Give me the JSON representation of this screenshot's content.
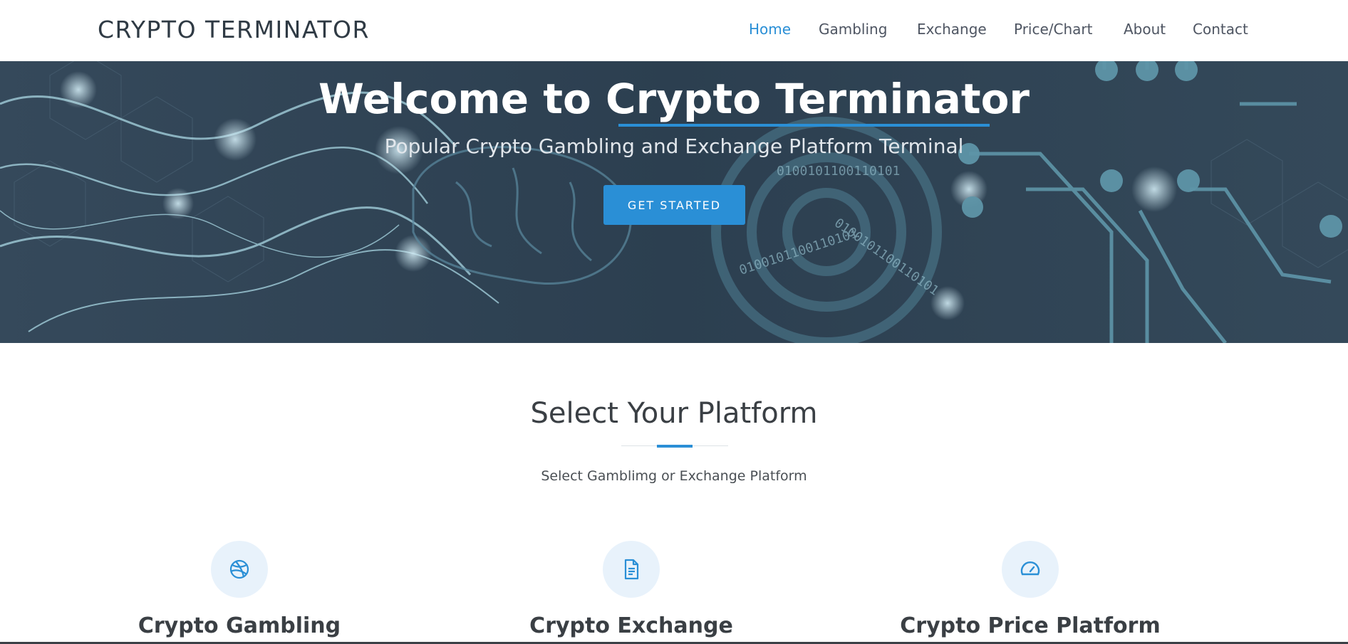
{
  "header": {
    "logo": "CRYPTO TERMINATOR",
    "nav": [
      {
        "label": "Home",
        "active": true
      },
      {
        "label": "Gambling",
        "active": false
      },
      {
        "label": "Exchange",
        "active": false
      },
      {
        "label": "Price/Chart",
        "active": false
      },
      {
        "label": "About",
        "active": false
      },
      {
        "label": "Contact",
        "active": false
      }
    ]
  },
  "hero": {
    "title_prefix": "Welcome to ",
    "title_highlight": "Crypto Terminator",
    "subtitle": "Popular Crypto Gambling and Exchange Platform Terminal",
    "cta_label": "GET STARTED",
    "background_text": "0100101100110101"
  },
  "section": {
    "title": "Select Your Platform",
    "description": "Select Gamblimg or Exchange Platform"
  },
  "cards": [
    {
      "title": "Crypto Gambling",
      "icon": "dribbble-icon"
    },
    {
      "title": "Crypto Exchange",
      "icon": "document-icon"
    },
    {
      "title": "Crypto Price Platform",
      "icon": "speedometer-icon"
    }
  ],
  "colors": {
    "accent": "#2a8fd6",
    "hero_bg": "#2d4153",
    "icon_circle": "#e8f2fb",
    "text_dark": "#3a3f44"
  }
}
